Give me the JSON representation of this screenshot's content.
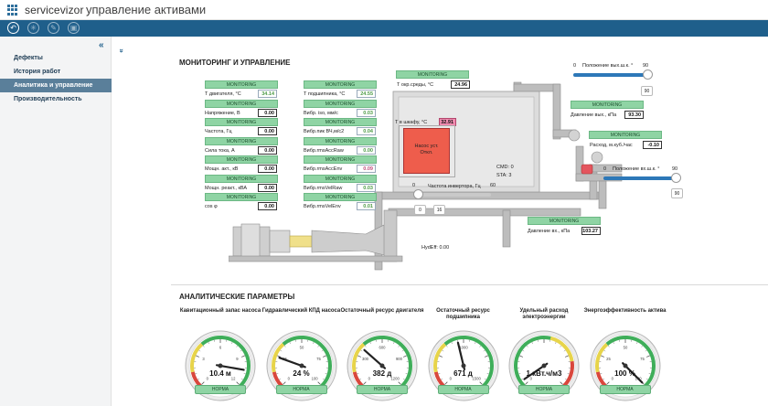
{
  "header": {
    "brand": "servicevizor",
    "title": "управление активами"
  },
  "sidebar": {
    "items": [
      {
        "label": "Дефекты"
      },
      {
        "label": "История работ"
      },
      {
        "label": "Аналитика и управление",
        "active": true
      },
      {
        "label": "Производительность"
      }
    ]
  },
  "monitoring": {
    "title": "МОНИТОРИНГ И УПРАВЛЕНИЕ",
    "badge": "MONITORING",
    "left_params": [
      {
        "label": "Т двигателя, °С",
        "value": "34.14",
        "style": "green"
      },
      {
        "label": "Напряжение, В",
        "value": "0.00",
        "style": "normal"
      },
      {
        "label": "Частота, Гц",
        "value": "0.00",
        "style": "normal"
      },
      {
        "label": "Сила тока, А",
        "value": "0.00",
        "style": "normal"
      },
      {
        "label": "Мощн. акт., кВ",
        "value": "0.00",
        "style": "normal"
      },
      {
        "label": "Мощн. реакт., кВА",
        "value": "0.00",
        "style": "normal"
      },
      {
        "label": "cos φ",
        "value": "0.00",
        "style": "normal"
      }
    ],
    "right_params": [
      {
        "label": "Т подшипника, °С",
        "value": "24.55",
        "style": "green"
      },
      {
        "label": "Вибр. iso, мм/с",
        "value": "0.03",
        "style": "green"
      },
      {
        "label": "Вибр.пик ВЧ,м/с2",
        "value": "0.04",
        "style": "green"
      },
      {
        "label": "Вибр.rmsAccRaw",
        "value": "0.00",
        "style": "green"
      },
      {
        "label": "Вибр.rmsAccEnv",
        "value": "0.09",
        "style": "pink"
      },
      {
        "label": "Вибр.rmsVelRaw",
        "value": "0.03",
        "style": "green"
      },
      {
        "label": "Вибр.rmsVelEnv",
        "value": "0.01",
        "style": "green"
      }
    ],
    "env_temp": {
      "label": "Т окр.среды, °С",
      "value": "24.96"
    },
    "cabinet_temp": {
      "label": "Т в шкафу, °С",
      "value": "32.91"
    },
    "pump_status": {
      "line1": "Насос уст.",
      "line2": "Откл."
    },
    "cmd": {
      "label": "CMD:",
      "value": "0"
    },
    "sta": {
      "label": "STA:",
      "value": "3"
    },
    "inverter": {
      "label": "Частота инвертора, Гц",
      "min": "0",
      "max": "60",
      "set_value": "0",
      "current": "16"
    },
    "hydeff": {
      "label": "HydEff:",
      "value": "0.00"
    },
    "outlet_valve": {
      "label": "Положение вых.ш.к. °",
      "min": "0",
      "max": "90",
      "value": "90"
    },
    "outlet_pressure": {
      "label": "Давление вых., кПа",
      "value": "93.30"
    },
    "flow": {
      "label": "Расход, м.куб./час",
      "value": "-0.10"
    },
    "inlet_valve": {
      "label": "Положение вх.ш.к. °",
      "min": "0",
      "max": "90",
      "value": "90"
    },
    "inlet_pressure": {
      "label": "Давление вх., кПа",
      "value": "103.27"
    }
  },
  "analytics": {
    "title": "АНАЛИТИЧЕСКИЕ ПАРАМЕТРЫ",
    "status_label": "НОРМА",
    "gauges": [
      {
        "title": "Кавитационный запас насоса",
        "value": "10.4 м",
        "needle_fraction": 0.87,
        "ticks": [
          "0",
          "3",
          "6",
          "9",
          "12"
        ],
        "scheme": "ryg"
      },
      {
        "title": "Гидравлический КПД насоса",
        "value": "24 %",
        "needle_fraction": 0.24,
        "ticks": [
          "0",
          "25",
          "50",
          "75",
          "100"
        ],
        "scheme": "ryg"
      },
      {
        "title": "Остаточный ресурс двигателя",
        "value": "382 д",
        "needle_fraction": 0.32,
        "ticks": [
          "0",
          "300",
          "600",
          "900",
          "1200"
        ],
        "scheme": "ryg"
      },
      {
        "title": "Остаточный ресурс подшипника",
        "value": "671 д",
        "needle_fraction": 0.45,
        "ticks": [
          "0",
          "",
          "1000",
          "",
          "1500"
        ],
        "scheme": "ryg"
      },
      {
        "title": "Удельный расход электроэнергии",
        "value": "1 кВт.ч/м3",
        "needle_fraction": 0.04,
        "ticks": [
          "0",
          "",
          "",
          "",
          ""
        ],
        "scheme": "gyr"
      },
      {
        "title": "Энергоэффективность актива",
        "value": "100 %",
        "needle_fraction": 1.0,
        "ticks": [
          "0",
          "25",
          "50",
          "75",
          "100"
        ],
        "scheme": "ryg"
      }
    ]
  },
  "colors": {
    "toolbar": "#1f5f8b",
    "badge": "#8fd4a4",
    "alarm": "#ee5d4c"
  }
}
